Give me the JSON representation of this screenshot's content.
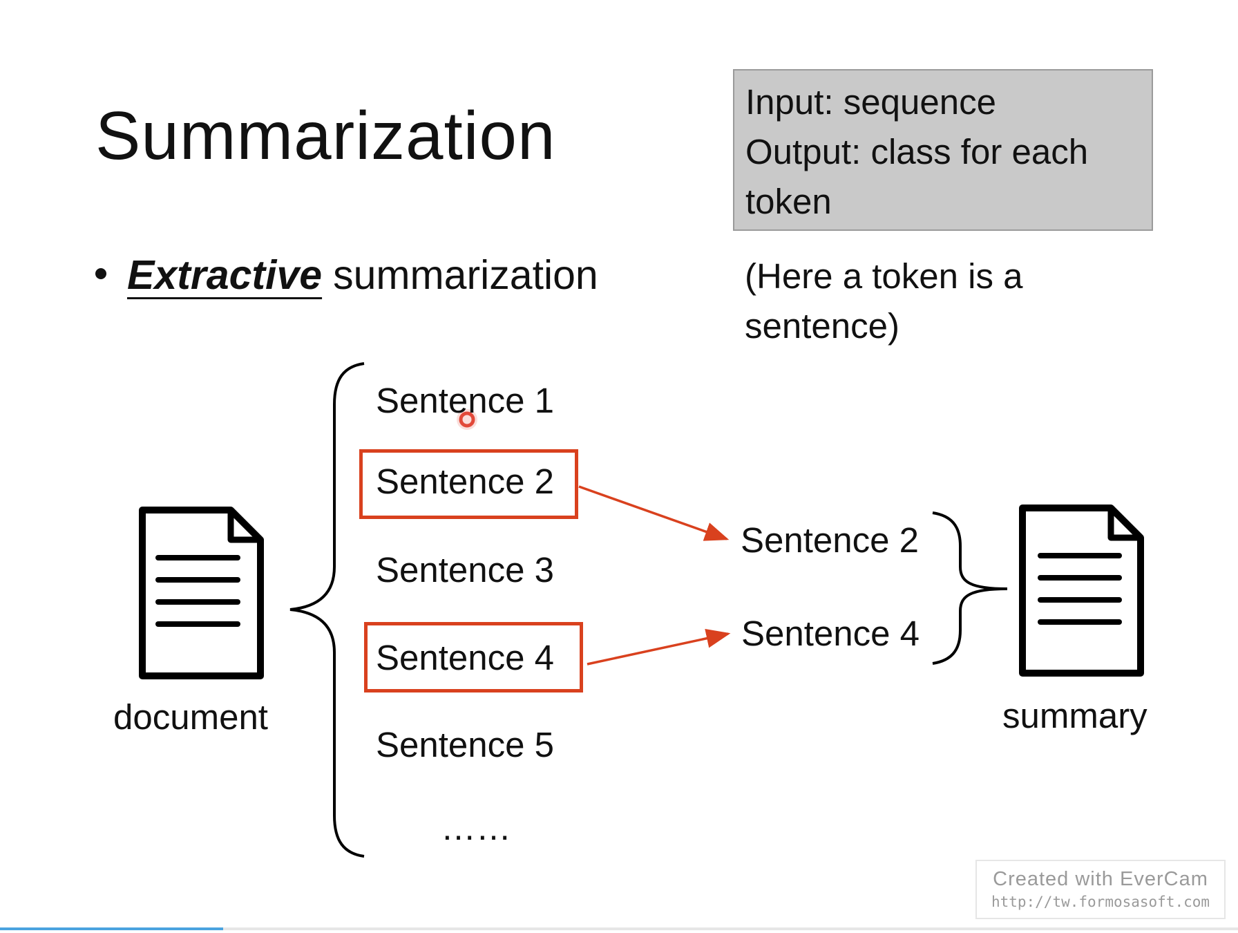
{
  "slide": {
    "title": "Summarization",
    "info_box": {
      "line1": "Input: sequence",
      "line2": "Output: class for each",
      "line3": "token"
    },
    "note": {
      "line1": "(Here a token is a",
      "line2": "sentence)"
    },
    "bullet": {
      "emphasis": "Extractive",
      "rest": "summarization"
    }
  },
  "diagram": {
    "document_label": "document",
    "summary_label": "summary",
    "sentences": [
      "Sentence 1",
      "Sentence 2",
      "Sentence 3",
      "Sentence 4",
      "Sentence 5"
    ],
    "ellipsis": "……",
    "selected": [
      "Sentence 2",
      "Sentence 4"
    ],
    "highlight_color": "#d9411e"
  },
  "watermark": {
    "line1": "Created  with  EverCam",
    "line2": "http://tw.formosasoft.com"
  },
  "video_progress": 0.18
}
